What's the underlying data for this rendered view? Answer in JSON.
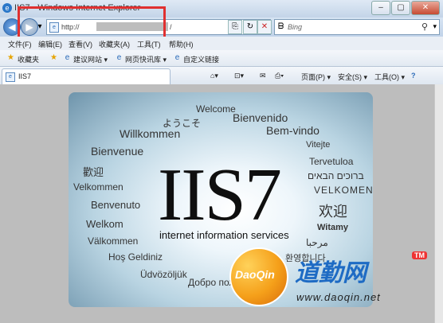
{
  "window": {
    "title": "IIS7 - Windows Internet Explorer"
  },
  "address": {
    "url": "http://",
    "url_tail": "/"
  },
  "search": {
    "placeholder": "Bing"
  },
  "menu": [
    {
      "label": "文件(F)"
    },
    {
      "label": "编辑(E)"
    },
    {
      "label": "查看(V)"
    },
    {
      "label": "收藏夹(A)"
    },
    {
      "label": "工具(T)"
    },
    {
      "label": "帮助(H)"
    }
  ],
  "favorites": {
    "label": "收藏夹",
    "items": [
      {
        "label": "建议网站 ▾"
      },
      {
        "label": "网页快讯库 ▾"
      },
      {
        "label": "自定义链接"
      }
    ]
  },
  "tab": {
    "title": "IIS7"
  },
  "commands": {
    "page": "页面(P) ▾",
    "safety": "安全(S) ▾",
    "tools": "工具(O) ▾",
    "help": "?"
  },
  "splash": {
    "title": "IIS7",
    "subtitle": "internet information services",
    "words": [
      {
        "text": "Welcome"
      },
      {
        "text": "ようこそ"
      },
      {
        "text": "Bienvenido"
      },
      {
        "text": "Willkommen"
      },
      {
        "text": "Bem-vindo"
      },
      {
        "text": "Bienvenue"
      },
      {
        "text": "Vitejte"
      },
      {
        "text": "Tervetuloa"
      },
      {
        "text": "歡迎"
      },
      {
        "text": "ברוכים הבאים"
      },
      {
        "text": "Velkommen"
      },
      {
        "text": "VELKOMEN"
      },
      {
        "text": "Benvenuto"
      },
      {
        "text": "欢迎"
      },
      {
        "text": "Welkom"
      },
      {
        "text": "Witamy"
      },
      {
        "text": "Välkommen"
      },
      {
        "text": "مرحبا"
      },
      {
        "text": "Hoş Geldiniz"
      },
      {
        "text": "환영합니다"
      },
      {
        "text": "Üdvözöljük"
      },
      {
        "text": "Добро пожаловать"
      }
    ]
  },
  "watermark": {
    "logo_text": "DaoQin",
    "brand": "道勤网",
    "badge": "TM",
    "url": "www.daoqin.net"
  }
}
